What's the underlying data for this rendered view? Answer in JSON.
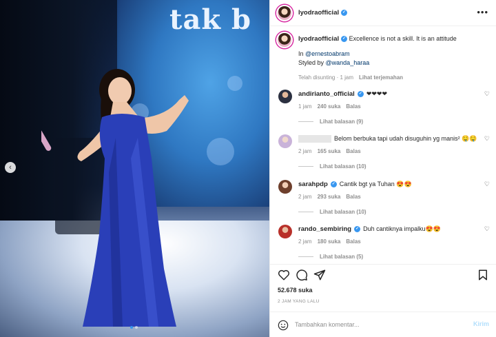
{
  "photo": {
    "background_text": "tak b",
    "carousel_total": 2,
    "carousel_active": 1
  },
  "post": {
    "username": "lyodraofficial",
    "more_icon": "more-horizontal-icon",
    "caption": {
      "text": "Excellence is not a skill. It is an attitude",
      "in_prefix": "In ",
      "in_mention": "@ernestoabram",
      "styled_prefix": "Styled by ",
      "styled_mention": "@wanda_haraa",
      "edited_time": "Telah disunting · 1 jam",
      "see_translation": "Lihat terjemahan"
    }
  },
  "comments": [
    {
      "username": "andirianto_official",
      "verified": true,
      "text": "❤❤❤❤",
      "time": "1 jam",
      "likes": "240 suka",
      "reply": "Balas",
      "view_replies": "Lihat balasan (9)",
      "avatar_color": "#2b3040"
    },
    {
      "username": "",
      "verified": false,
      "redacted": true,
      "text": "Belom berbuka tapi udah disuguhin yg manis² 🤤🤤",
      "time": "2 jam",
      "likes": "165 suka",
      "reply": "Balas",
      "view_replies": "Lihat balasan (10)",
      "avatar_color": "#d9c6e6"
    },
    {
      "username": "sarahpdp",
      "verified": true,
      "text": "Cantik bgt ya Tuhan 😍😍",
      "time": "2 jam",
      "likes": "293 suka",
      "reply": "Balas",
      "view_replies": "Lihat balasan (10)",
      "avatar_color": "#8a5a44"
    },
    {
      "username": "rando_sembiring",
      "verified": true,
      "text": "Duh cantiknya impalku😍😍",
      "time": "2 jam",
      "likes": "180 suka",
      "reply": "Balas",
      "view_replies": "Lihat balasan (5)",
      "avatar_color": "#b8302a"
    }
  ],
  "actions": {
    "like_icon": "heart-icon",
    "comment_icon": "comment-icon",
    "share_icon": "send-icon",
    "save_icon": "bookmark-icon"
  },
  "likes_count": "52.678 suka",
  "time_ago": "2 JAM YANG LALU",
  "add_comment": {
    "emoji_icon": "smiley-icon",
    "placeholder": "Tambahkan komentar...",
    "post_label": "Kirim"
  },
  "colors": {
    "link": "#00376b",
    "verified": "#3897f0",
    "muted": "#8e8e8e",
    "post_disabled": "#b2dffc"
  }
}
